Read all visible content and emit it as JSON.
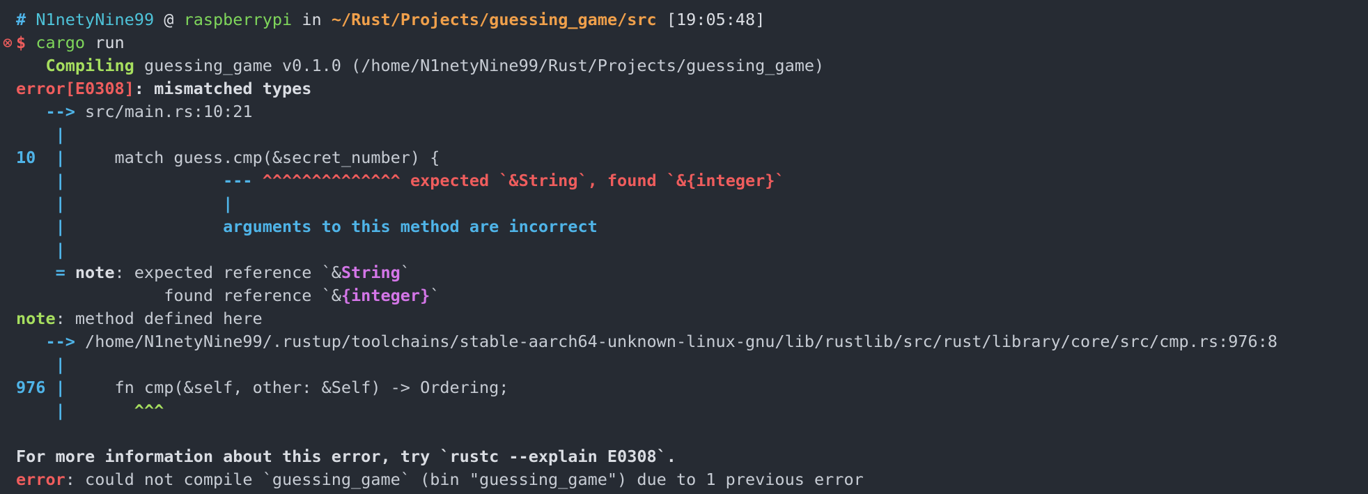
{
  "prompt": {
    "hash": "#",
    "user": "N1netyNine99",
    "at": "@",
    "host": "raspberrypi",
    "in": "in",
    "path": "~/Rust/Projects/guessing_game/src",
    "time": "[19:05:48]",
    "error_mark": "⊗",
    "dollar": "$",
    "command": "cargo",
    "args": "run"
  },
  "output": {
    "compiling_indent": "   ",
    "compiling_label": "Compiling",
    "compiling_target": " guessing_game v0.1.0 (/home/N1netyNine99/Rust/Projects/guessing_game)",
    "error_code": "error[E0308]",
    "error_msg": ": mismatched types",
    "arrow1_indent": "   ",
    "arrow1": "-->",
    "arrow1_loc": " src/main.rs:10:21",
    "pipe_indent": "    ",
    "pipe": "|",
    "line10_num": "10",
    "line10_sep": "  |",
    "line10_code": "     match guess.cmp(&secret_number) {",
    "marker_pad": "                ",
    "marker_dashes": "---",
    "marker_carets": " ^^^^^^^^^^^^^^ expected `&String`, found `&{integer}`",
    "marker_pipe": "|",
    "marker_label": "arguments to this method are incorrect",
    "note_eq": "    = ",
    "note_label": "note",
    "note_text1": ": expected reference `&",
    "note_type1": "String",
    "note_tick1": "`",
    "note_text2": "               found reference `&",
    "note_type2": "{integer}",
    "note_tick2": "`",
    "note2_label": "note",
    "note2_text": ": method defined here",
    "arrow2_indent": "   ",
    "arrow2": "-->",
    "arrow2_loc": " /home/N1netyNine99/.rustup/toolchains/stable-aarch64-unknown-linux-gnu/lib/rustlib/src/rust/library/core/src/cmp.rs:976:8",
    "line976_num": "976",
    "line976_sep": " |",
    "line976_code": "     fn cmp(&self, other: &Self) -> Ordering;",
    "carets976_pad": "       ",
    "carets976": "^^^",
    "info": "For more information about this error, try `rustc --explain E0308`.",
    "final_error_label": "error",
    "final_error_text": ": could not compile `guessing_game` (bin \"guessing_game\") due to 1 previous error"
  },
  "colors": {
    "background": "#262b33",
    "text": "#c7ccd4",
    "blue": "#4fb4e8",
    "green": "#7fd65b",
    "orange": "#f0a04b",
    "red": "#ef5d5d",
    "magenta": "#d476e8"
  }
}
